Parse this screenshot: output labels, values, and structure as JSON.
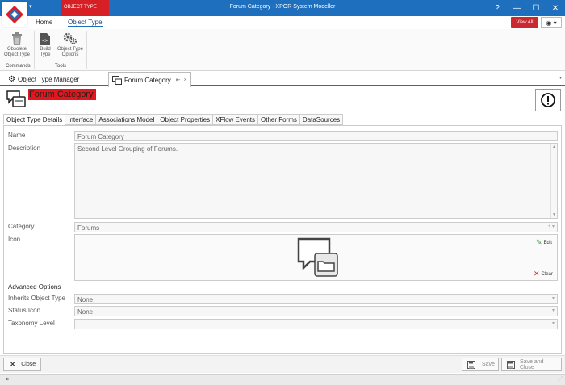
{
  "window": {
    "title": "Forum Category - XPOR System Modeller",
    "context_tab": "OBJECT TYPE",
    "help": "?",
    "minimize": "—",
    "maximize": "☐",
    "close": "✕"
  },
  "ribbon": {
    "tabs": [
      "Home",
      "Object Type"
    ],
    "view_all": "View All",
    "eye_menu": "◉ ▾",
    "groups": [
      {
        "label": "Commands",
        "buttons": [
          {
            "label": "Obsolete Object Type",
            "icon": "trash-icon"
          }
        ]
      },
      {
        "label": "Tools",
        "buttons": [
          {
            "label": "Build Type",
            "icon": "build-code-icon"
          },
          {
            "label": "Object Type Options",
            "icon": "gears-icon"
          }
        ]
      }
    ]
  },
  "doc_tabs": [
    {
      "label": "Object Type Manager",
      "icon": "gear-icon"
    },
    {
      "label": "Forum Category",
      "icon": "forum-category-icon",
      "pin": "⇤",
      "close": "×"
    }
  ],
  "header": {
    "title": "Forum Category",
    "alert": "!"
  },
  "content_tabs": [
    "Object Type Details",
    "Interface",
    "Associations Model",
    "Object Properties",
    "XFlow Events",
    "Other Forms",
    "DataSources"
  ],
  "form": {
    "name_label": "Name",
    "name_value": "Forum Category",
    "description_label": "Description",
    "description_value": "Second Level Grouping of Forums.",
    "category_label": "Category",
    "category_value": "Forums",
    "icon_label": "Icon",
    "edit_label": "Edit",
    "clear_label": "Clear",
    "advanced_label": "Advanced Options",
    "inherits_label": "Inherits Object Type",
    "inherits_value": "None",
    "status_icon_label": "Status Icon",
    "status_icon_value": "None",
    "taxonomy_label": "Taxonomy Level",
    "taxonomy_value": ""
  },
  "footer": {
    "close_label": "Close",
    "save_label": "Save",
    "save_close_label": "Save and Close"
  },
  "colors": {
    "titlebar": "#1e6fbd",
    "accent_red": "#e3161e"
  }
}
